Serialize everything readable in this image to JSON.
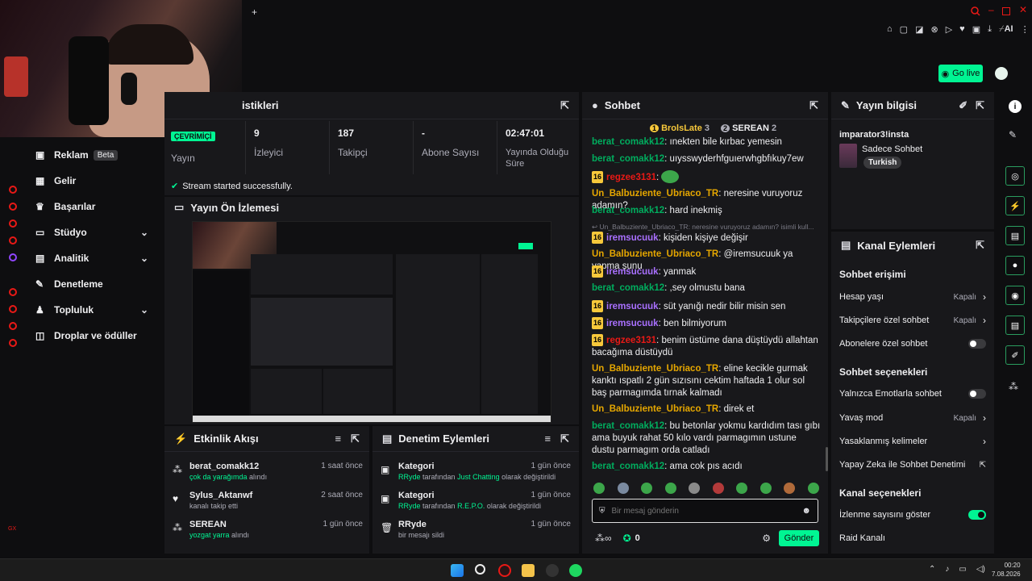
{
  "topbar": {
    "go_live": "Go live",
    "ai_label": "AI"
  },
  "stats": {
    "title": "istikleri",
    "items": [
      {
        "value": "",
        "label": "Yayın"
      },
      {
        "value": "9",
        "label": "İzleyici"
      },
      {
        "value": "187",
        "label": "Takipçi"
      },
      {
        "value": "-",
        "label": "Abone Sayısı"
      },
      {
        "value": "02:47:01",
        "label": "Yayında Olduğu Süre"
      }
    ],
    "badge": "ÇEVRİMİÇİ",
    "success": "Stream started successfully."
  },
  "preview": {
    "title": "Yayın Ön İzlemesi"
  },
  "nav": {
    "items": [
      {
        "label": "Reklam",
        "badge": "Beta"
      },
      {
        "label": "Gelir"
      },
      {
        "label": "Başarılar"
      },
      {
        "label": "Stüdyo"
      },
      {
        "label": "Analitik"
      },
      {
        "label": "Denetleme"
      },
      {
        "label": "Topluluk"
      },
      {
        "label": "Droplar ve ödüller"
      }
    ],
    "rail_bottom": "GX"
  },
  "activity": {
    "title": "Etkinlik Akışı",
    "items": [
      {
        "user": "berat_comakk12",
        "time": "1 saat önce",
        "pre": "",
        "highlight": "çok da yarağımda",
        "post": " alındı"
      },
      {
        "user": "Sylus_Aktanwf",
        "time": "2 saat önce",
        "pre": "kanalı takip etti",
        "highlight": "",
        "post": ""
      },
      {
        "user": "SEREAN",
        "time": "1 gün önce",
        "pre": "",
        "highlight": "yozgat yarra",
        "post": " alındı"
      }
    ]
  },
  "moderation": {
    "title": "Denetim Eylemleri",
    "items": [
      {
        "title": "Kategori",
        "time": "1 gün önce",
        "by": "RRyde",
        "mid": " tarafından ",
        "highlight": "Just Chatting",
        "post": " olarak değiştirildi"
      },
      {
        "title": "Kategori",
        "time": "1 gün önce",
        "by": "RRyde",
        "mid": " tarafından ",
        "highlight": "R.E.P.O.",
        "post": " olarak değiştirildi"
      },
      {
        "title": "RRyde",
        "time": "1 gün önce",
        "by": "",
        "mid": "bir mesajı sildi",
        "highlight": "",
        "post": ""
      }
    ]
  },
  "chat": {
    "title": "Sohbet",
    "leaders": [
      {
        "rank": "1",
        "name": "BrolsLate",
        "count": "3"
      },
      {
        "rank": "2",
        "name": "SEREAN",
        "count": "2"
      }
    ],
    "reply_preview": "Un_Balbuziente_Ubriaco_TR: neresine vuruyoruz adamın? isimli kull...",
    "messages": [
      {
        "user": "berat_comakk12",
        "text": "ınekten bile kırbac yemesin"
      },
      {
        "user": "berat_comakk12",
        "text": "uıysswyderhfguıerwhgbfıkuy7ew"
      },
      {
        "user": "regzee3131",
        "text": ""
      },
      {
        "user": "Un_Balbuziente_Ubriaco_TR",
        "text": "neresine vuruyoruz adamın?"
      },
      {
        "user": "berat_comakk12",
        "text": "hard inekmiş"
      },
      {
        "user": "iremsucuuk",
        "text": "kişiden kişiye değişir"
      },
      {
        "user": "Un_Balbuziente_Ubriaco_TR",
        "text": "@iremsucuuk ya yapma şunu"
      },
      {
        "user": "iremsucuuk",
        "text": "yanmak"
      },
      {
        "user": "berat_comakk12",
        "text": ",sey olmustu bana"
      },
      {
        "user": "iremsucuuk",
        "text": "süt yanığı nedir bilir misin sen"
      },
      {
        "user": "iremsucuuk",
        "text": "ben bilmiyorum"
      },
      {
        "user": "regzee3131",
        "text": "benim üstüme dana düştüydü allahtan bacağıma düstüydü"
      },
      {
        "user": "Un_Balbuziente_Ubriaco_TR",
        "text": "eline kecikle gurmak kanktı ıspatlı 2 gün sızısını cektim haftada 1 olur sol baş parmagımda tırnak kalmadı"
      },
      {
        "user": "Un_Balbuziente_Ubriaco_TR",
        "text": "direk et"
      },
      {
        "user": "berat_comakk12",
        "text": "bu betonlar yokmu kardıdım tası gıbı ama buyuk rahat 50 kılo vardı parmagımın ustune dustu parmagım orda catladı"
      },
      {
        "user": "berat_comakk12",
        "text": "ama cok pıs acıdı"
      }
    ],
    "sub_badge": "16",
    "input_placeholder": "Bir mesaj gönderin",
    "points": "0",
    "send": "Gönder"
  },
  "stream_info": {
    "title": "Yayın bilgisi",
    "stream_title": "imparator3!insta",
    "category": "Sadece Sohbet",
    "tag": "Turkish"
  },
  "channel_actions": {
    "title": "Kanal Eylemleri",
    "chat_access": "Sohbet erişimi",
    "account_age": "Hesap yaşı",
    "account_age_value": "Kapalı",
    "followers_only": "Takipçilere özel sohbet",
    "followers_only_value": "Kapalı",
    "subs_only": "Abonelere özel sohbet",
    "chat_options": "Sohbet seçenekleri",
    "emote_only": "Yalnızca Emotlarla sohbet",
    "slow_mode": "Yavaş mod",
    "slow_mode_value": "Kapalı",
    "banned_words": "Yasaklanmış kelimeler",
    "ai_mod": "Yapay Zeka ile Sohbet Denetimi",
    "channel_options": "Kanal seçenekleri",
    "show_viewers": "İzlenme sayısını göster",
    "raid": "Raid Kanalı"
  },
  "taskbar": {
    "time": "00:20",
    "date": "7.08.2026"
  },
  "colors": {
    "accent": "#00f593",
    "panel": "#18181b",
    "bg": "#0e0e10"
  }
}
